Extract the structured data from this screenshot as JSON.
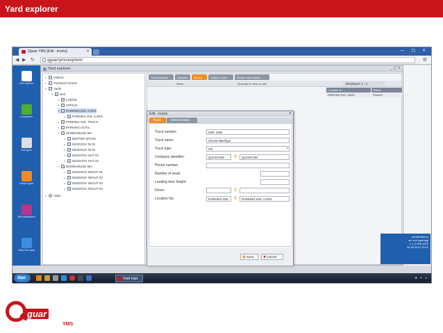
{
  "slide": {
    "title": "Yard explorer"
  },
  "browser": {
    "tab_title": "Qguar YMS [Edit - trucks]",
    "close_glyph": "×",
    "url": "qguar/yms/explorer",
    "window_controls": "— □ ×"
  },
  "left_panel": {
    "items": [
      {
        "label": "Yard explorer",
        "icon": "yard-explorer-icon",
        "color": "#ffffff"
      },
      {
        "label": "Companies",
        "icon": "companies-icon",
        "color": "#4caf30"
      },
      {
        "label": "Visit types",
        "icon": "printer-icon",
        "color": "#e0e0e0"
      },
      {
        "label": "Vehicle types",
        "icon": "truck-icon",
        "color": "#f28c1c"
      },
      {
        "label": "Visit notifications",
        "icon": "message-icon",
        "color": "#b8348c"
      },
      {
        "label": "Visits info mass",
        "icon": "info-icon",
        "color": "#3c8fe0"
      }
    ]
  },
  "yard_window": {
    "title": "Yard explorer",
    "controls": "_ □ ×"
  },
  "tree": {
    "nodes": [
      {
        "label": "Visitors",
        "indent": 0
      },
      {
        "label": "Transport means",
        "indent": 0
      },
      {
        "label": "Yards",
        "indent": 0
      },
      {
        "label": "ws3",
        "indent": 1
      },
      {
        "label": "LODGE",
        "indent": 2
      },
      {
        "label": "OFFICE",
        "indent": 2
      },
      {
        "label": "PARKING INS. CARS",
        "indent": 2
      },
      {
        "label": "PARKING INS. CARS",
        "indent": 3
      },
      {
        "label": "PARKING INS. TRUCK",
        "indent": 2
      },
      {
        "label": "PARKING OUTS.",
        "indent": 2
      },
      {
        "label": "WAREHOUSE MC",
        "indent": 2
      },
      {
        "label": "BUFFER SPACE",
        "indent": 3
      },
      {
        "label": "MC/DOCK IN 01",
        "indent": 3
      },
      {
        "label": "MC/DOCK IN 02",
        "indent": 3
      },
      {
        "label": "MC/DOCK OUT 01",
        "indent": 3
      },
      {
        "label": "MC/DOCK OUT 02",
        "indent": 3
      },
      {
        "label": "WAREHOUSE MU",
        "indent": 2
      },
      {
        "label": "MU/DOCK IN/OUT 01",
        "indent": 3
      },
      {
        "label": "MU/DOCK IN/OUT 02",
        "indent": 3
      },
      {
        "label": "MU/DOCK IN/OUT 03",
        "indent": 3
      },
      {
        "label": "MU/DOCK IN/OUT 04",
        "indent": 3
      },
      {
        "label": "Visits",
        "indent": 0
      }
    ]
  },
  "main_panel": {
    "tabs": [
      {
        "label": "Yard locations",
        "color": "#8a95a5"
      },
      {
        "label": "Gantries",
        "color": "#8a95a5"
      },
      {
        "label": "Trucks",
        "color": "#f28c1c"
      },
      {
        "label": "Trailer in yard",
        "color": "#8a95a5"
      },
      {
        "label": "Virtual reservations",
        "color": "#8a95a5"
      }
    ],
    "toolbar_show": "Show",
    "toolbar_quantity": "Quantity of rows on site",
    "displayed": "Displayed: 1 - 1",
    "columns": [
      "Location No",
      "Status"
    ],
    "row": [
      "PARKING INS. CARS",
      "Present"
    ]
  },
  "dialog": {
    "title": "Edit - trucks",
    "close_glyph": "×",
    "tabs": [
      {
        "label": "Truck",
        "active": true
      },
      {
        "label": "Administration",
        "active": false
      }
    ],
    "fields": {
      "truck_number": {
        "label": "Truck number:",
        "value": "KRK 1002"
      },
      "truck_name": {
        "label": "Truck name:",
        "value": "Citroen Berlingo"
      },
      "truck_type": {
        "label": "Truck type:",
        "value": "OS"
      },
      "company_identifier": {
        "label": "Company identifier:",
        "value": "QUANTUM",
        "value2": "QUANTUM"
      },
      "phone_number": {
        "label": "Phone number:",
        "value": ""
      },
      "number_of_seals": {
        "label": "Number of seals:",
        "value": ""
      },
      "loading_door_height": {
        "label": "Loading door height:",
        "value": ""
      },
      "driver": {
        "label": "Driver:",
        "value": "",
        "value2": ""
      },
      "location_no": {
        "label": "Location No:",
        "value": "PARKING INS.",
        "value2": "PARKING INS. CARS"
      }
    },
    "buttons": {
      "save": "Save",
      "cancel": "Cancel"
    }
  },
  "status_box": {
    "lines": [
      "yms@Safena",
      "as: vmi-sapblogi",
      "v. 1.2.000.4475",
      "10.05.2012 10:01"
    ]
  },
  "taskbar": {
    "start": "Start",
    "app": "Yard expl.",
    "tray": "◂ ▪ ♪"
  },
  "logo": {
    "word": "guar",
    "product": "YMS",
    "brand_color": "#c8151b"
  },
  "colors": {
    "header": "#c8151b",
    "panel_blue": "#1f5fae",
    "accent_orange": "#f28c1c"
  }
}
